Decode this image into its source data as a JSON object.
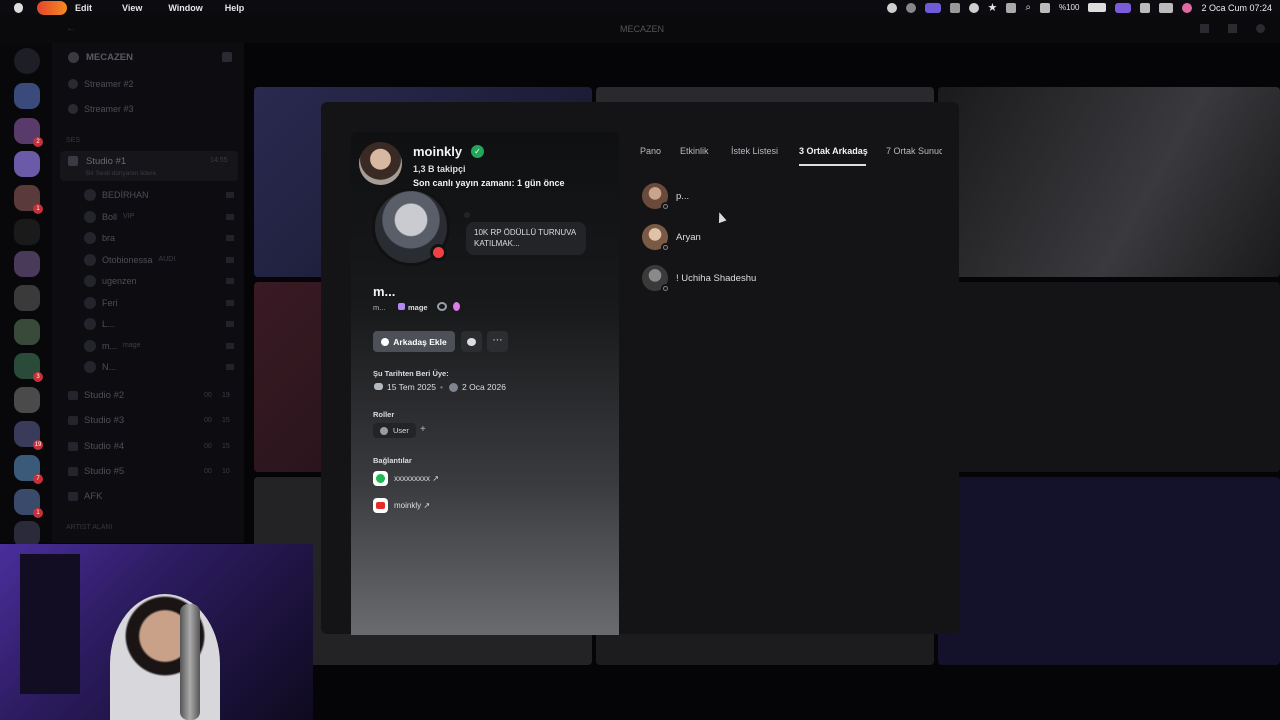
{
  "menubar": {
    "items": [
      "Edit",
      "View",
      "Window",
      "Help"
    ],
    "battery": "%100",
    "datetime": "2 Oca Cum  07:24"
  },
  "window": {
    "title": "MECAZEN"
  },
  "sidebar": {
    "server_name": "MECAZEN",
    "channels": [
      {
        "label": "Streamer #2"
      },
      {
        "label": "Streamer #3"
      }
    ],
    "section": "SES",
    "active_voice": {
      "label": "Studio #1",
      "time": "14:55",
      "status": "Bir Sesli dünyanın lidere"
    },
    "members": [
      {
        "name": "BEDİRHAN"
      },
      {
        "name": "Boll",
        "tag": "VIP"
      },
      {
        "name": "bra"
      },
      {
        "name": "Otobionessa",
        "tag": "AUDI"
      },
      {
        "name": "ugenzen"
      },
      {
        "name": "Feri"
      },
      {
        "name": "L..."
      },
      {
        "name": "m...",
        "tag": "mage"
      },
      {
        "name": "N..."
      }
    ],
    "voice_channels": [
      {
        "label": "Studio #2",
        "a": "00",
        "b": "19"
      },
      {
        "label": "Studio #3",
        "a": "00",
        "b": "15"
      },
      {
        "label": "Studio #4",
        "a": "00",
        "b": "15"
      },
      {
        "label": "Studio #5",
        "a": "00",
        "b": "10"
      },
      {
        "label": "AFK"
      }
    ],
    "section2": "ARTIST ALANI"
  },
  "profile": {
    "display_name": "moinkly",
    "followers": "1,3 B takipçi",
    "last_stream": "Son canlı yayın zamanı: 1 gün önce",
    "status_bubble": "10K RP ÖDÜLLÜ TURNUVA KATILMAK...",
    "username": "m...",
    "sub": "m...",
    "badge": "mage",
    "add_friend": "Arkadaş Ekle",
    "member_since_label": "Şu Tarihten Beri Üye:",
    "member_since_discord": "15 Tem 2025",
    "member_since_server": "2 Oca 2026",
    "roles_label": "Roller",
    "role": "User",
    "links_label": "Bağlantılar",
    "links": [
      {
        "label": "xxxxxxxxx ↗",
        "icon": "spotify-icon",
        "color": "#1db954"
      },
      {
        "label": "moinkly ↗",
        "icon": "youtube-icon",
        "color": "#e52d27"
      }
    ]
  },
  "tabs": [
    {
      "label": "Pano"
    },
    {
      "label": "Etkinlik"
    },
    {
      "label": "İstek Listesi"
    },
    {
      "label": "3 Ortak Arkadaş"
    },
    {
      "label": "7 Ortak Sunuc"
    }
  ],
  "mutual_friends": [
    {
      "name": "p..."
    },
    {
      "name": "Aryan"
    },
    {
      "name": "! Uchiha Shadeshu"
    }
  ],
  "colors": {
    "accent": "#5865f2",
    "online": "#23a55a",
    "verified": "#23a55a",
    "dnd": "#f23f43"
  }
}
